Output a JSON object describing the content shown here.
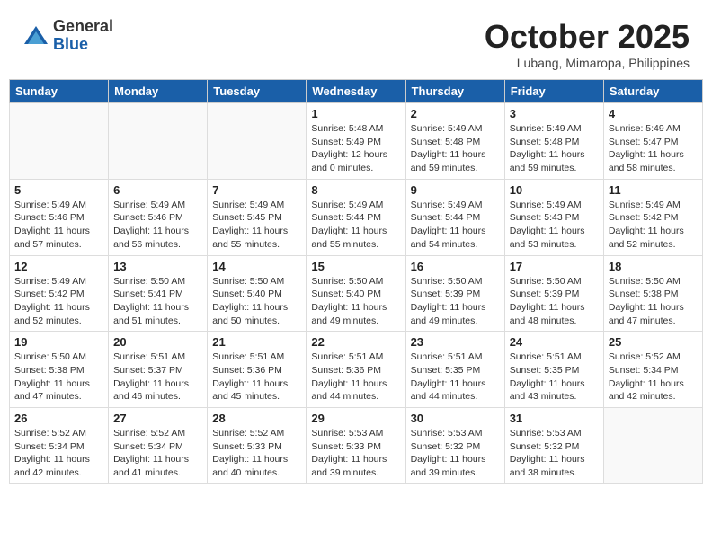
{
  "header": {
    "logo_general": "General",
    "logo_blue": "Blue",
    "title": "October 2025",
    "subtitle": "Lubang, Mimaropa, Philippines"
  },
  "weekdays": [
    "Sunday",
    "Monday",
    "Tuesday",
    "Wednesday",
    "Thursday",
    "Friday",
    "Saturday"
  ],
  "weeks": [
    [
      {
        "day": "",
        "sunrise": "",
        "sunset": "",
        "daylight": ""
      },
      {
        "day": "",
        "sunrise": "",
        "sunset": "",
        "daylight": ""
      },
      {
        "day": "",
        "sunrise": "",
        "sunset": "",
        "daylight": ""
      },
      {
        "day": "1",
        "sunrise": "5:48 AM",
        "sunset": "5:49 PM",
        "daylight": "12 hours and 0 minutes."
      },
      {
        "day": "2",
        "sunrise": "5:49 AM",
        "sunset": "5:48 PM",
        "daylight": "11 hours and 59 minutes."
      },
      {
        "day": "3",
        "sunrise": "5:49 AM",
        "sunset": "5:48 PM",
        "daylight": "11 hours and 59 minutes."
      },
      {
        "day": "4",
        "sunrise": "5:49 AM",
        "sunset": "5:47 PM",
        "daylight": "11 hours and 58 minutes."
      }
    ],
    [
      {
        "day": "5",
        "sunrise": "5:49 AM",
        "sunset": "5:46 PM",
        "daylight": "11 hours and 57 minutes."
      },
      {
        "day": "6",
        "sunrise": "5:49 AM",
        "sunset": "5:46 PM",
        "daylight": "11 hours and 56 minutes."
      },
      {
        "day": "7",
        "sunrise": "5:49 AM",
        "sunset": "5:45 PM",
        "daylight": "11 hours and 55 minutes."
      },
      {
        "day": "8",
        "sunrise": "5:49 AM",
        "sunset": "5:44 PM",
        "daylight": "11 hours and 55 minutes."
      },
      {
        "day": "9",
        "sunrise": "5:49 AM",
        "sunset": "5:44 PM",
        "daylight": "11 hours and 54 minutes."
      },
      {
        "day": "10",
        "sunrise": "5:49 AM",
        "sunset": "5:43 PM",
        "daylight": "11 hours and 53 minutes."
      },
      {
        "day": "11",
        "sunrise": "5:49 AM",
        "sunset": "5:42 PM",
        "daylight": "11 hours and 52 minutes."
      }
    ],
    [
      {
        "day": "12",
        "sunrise": "5:49 AM",
        "sunset": "5:42 PM",
        "daylight": "11 hours and 52 minutes."
      },
      {
        "day": "13",
        "sunrise": "5:50 AM",
        "sunset": "5:41 PM",
        "daylight": "11 hours and 51 minutes."
      },
      {
        "day": "14",
        "sunrise": "5:50 AM",
        "sunset": "5:40 PM",
        "daylight": "11 hours and 50 minutes."
      },
      {
        "day": "15",
        "sunrise": "5:50 AM",
        "sunset": "5:40 PM",
        "daylight": "11 hours and 49 minutes."
      },
      {
        "day": "16",
        "sunrise": "5:50 AM",
        "sunset": "5:39 PM",
        "daylight": "11 hours and 49 minutes."
      },
      {
        "day": "17",
        "sunrise": "5:50 AM",
        "sunset": "5:39 PM",
        "daylight": "11 hours and 48 minutes."
      },
      {
        "day": "18",
        "sunrise": "5:50 AM",
        "sunset": "5:38 PM",
        "daylight": "11 hours and 47 minutes."
      }
    ],
    [
      {
        "day": "19",
        "sunrise": "5:50 AM",
        "sunset": "5:38 PM",
        "daylight": "11 hours and 47 minutes."
      },
      {
        "day": "20",
        "sunrise": "5:51 AM",
        "sunset": "5:37 PM",
        "daylight": "11 hours and 46 minutes."
      },
      {
        "day": "21",
        "sunrise": "5:51 AM",
        "sunset": "5:36 PM",
        "daylight": "11 hours and 45 minutes."
      },
      {
        "day": "22",
        "sunrise": "5:51 AM",
        "sunset": "5:36 PM",
        "daylight": "11 hours and 44 minutes."
      },
      {
        "day": "23",
        "sunrise": "5:51 AM",
        "sunset": "5:35 PM",
        "daylight": "11 hours and 44 minutes."
      },
      {
        "day": "24",
        "sunrise": "5:51 AM",
        "sunset": "5:35 PM",
        "daylight": "11 hours and 43 minutes."
      },
      {
        "day": "25",
        "sunrise": "5:52 AM",
        "sunset": "5:34 PM",
        "daylight": "11 hours and 42 minutes."
      }
    ],
    [
      {
        "day": "26",
        "sunrise": "5:52 AM",
        "sunset": "5:34 PM",
        "daylight": "11 hours and 42 minutes."
      },
      {
        "day": "27",
        "sunrise": "5:52 AM",
        "sunset": "5:34 PM",
        "daylight": "11 hours and 41 minutes."
      },
      {
        "day": "28",
        "sunrise": "5:52 AM",
        "sunset": "5:33 PM",
        "daylight": "11 hours and 40 minutes."
      },
      {
        "day": "29",
        "sunrise": "5:53 AM",
        "sunset": "5:33 PM",
        "daylight": "11 hours and 39 minutes."
      },
      {
        "day": "30",
        "sunrise": "5:53 AM",
        "sunset": "5:32 PM",
        "daylight": "11 hours and 39 minutes."
      },
      {
        "day": "31",
        "sunrise": "5:53 AM",
        "sunset": "5:32 PM",
        "daylight": "11 hours and 38 minutes."
      },
      {
        "day": "",
        "sunrise": "",
        "sunset": "",
        "daylight": ""
      }
    ]
  ]
}
